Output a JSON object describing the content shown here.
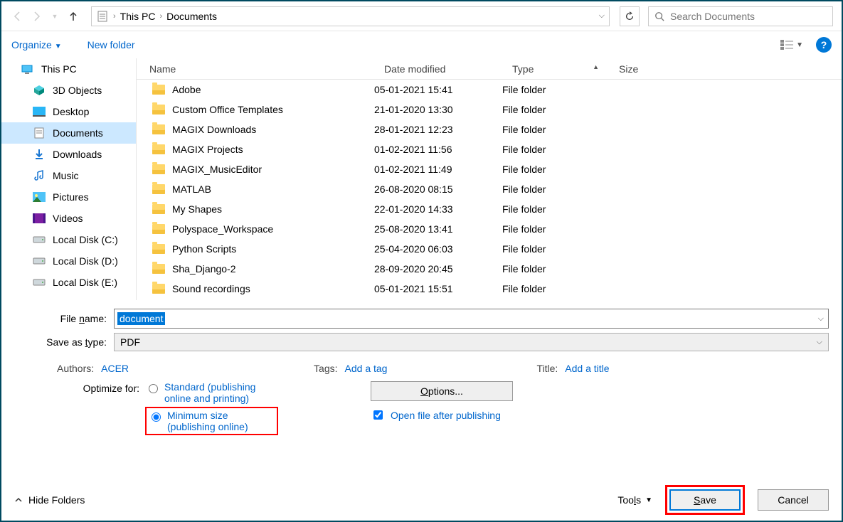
{
  "nav": {
    "breadcrumb": [
      "This PC",
      "Documents"
    ],
    "search_placeholder": "Search Documents"
  },
  "toolbar": {
    "organize": "Organize",
    "newfolder": "New folder"
  },
  "sidebar": [
    {
      "label": "This PC",
      "icon": "pc",
      "indent": 0
    },
    {
      "label": "3D Objects",
      "icon": "cube",
      "indent": 1
    },
    {
      "label": "Desktop",
      "icon": "desktop",
      "indent": 1
    },
    {
      "label": "Documents",
      "icon": "doc",
      "indent": 1,
      "selected": true
    },
    {
      "label": "Downloads",
      "icon": "down",
      "indent": 1
    },
    {
      "label": "Music",
      "icon": "music",
      "indent": 1
    },
    {
      "label": "Pictures",
      "icon": "pic",
      "indent": 1
    },
    {
      "label": "Videos",
      "icon": "vid",
      "indent": 1
    },
    {
      "label": "Local Disk (C:)",
      "icon": "disk",
      "indent": 1
    },
    {
      "label": "Local Disk (D:)",
      "icon": "disk",
      "indent": 1
    },
    {
      "label": "Local Disk (E:)",
      "icon": "disk",
      "indent": 1
    }
  ],
  "columns": {
    "name": "Name",
    "date": "Date modified",
    "type": "Type",
    "size": "Size"
  },
  "files": [
    {
      "name": "Adobe",
      "date": "05-01-2021 15:41",
      "type": "File folder"
    },
    {
      "name": "Custom Office Templates",
      "date": "21-01-2020 13:30",
      "type": "File folder"
    },
    {
      "name": "MAGIX Downloads",
      "date": "28-01-2021 12:23",
      "type": "File folder"
    },
    {
      "name": "MAGIX Projects",
      "date": "01-02-2021 11:56",
      "type": "File folder"
    },
    {
      "name": "MAGIX_MusicEditor",
      "date": "01-02-2021 11:49",
      "type": "File folder"
    },
    {
      "name": "MATLAB",
      "date": "26-08-2020 08:15",
      "type": "File folder"
    },
    {
      "name": "My Shapes",
      "date": "22-01-2020 14:33",
      "type": "File folder"
    },
    {
      "name": "Polyspace_Workspace",
      "date": "25-08-2020 13:41",
      "type": "File folder"
    },
    {
      "name": "Python Scripts",
      "date": "25-04-2020 06:03",
      "type": "File folder"
    },
    {
      "name": "Sha_Django-2",
      "date": "28-09-2020 20:45",
      "type": "File folder"
    },
    {
      "name": "Sound recordings",
      "date": "05-01-2021 15:51",
      "type": "File folder"
    }
  ],
  "form": {
    "filename_label": "File name:",
    "filename_value": "document",
    "saveas_label": "Save as type:",
    "saveas_value": "PDF"
  },
  "meta": {
    "authors_label": "Authors:",
    "authors_value": "ACER",
    "tags_label": "Tags:",
    "tags_value": "Add a tag",
    "title_label": "Title:",
    "title_value": "Add a title"
  },
  "optimize": {
    "label": "Optimize for:",
    "standard": "Standard (publishing online and printing)",
    "minimum": "Minimum size (publishing online)"
  },
  "options": {
    "button": "Options...",
    "checkbox": "Open file after publishing"
  },
  "footer": {
    "hide": "Hide Folders",
    "tools": "Tools",
    "save": "Save",
    "cancel": "Cancel"
  }
}
